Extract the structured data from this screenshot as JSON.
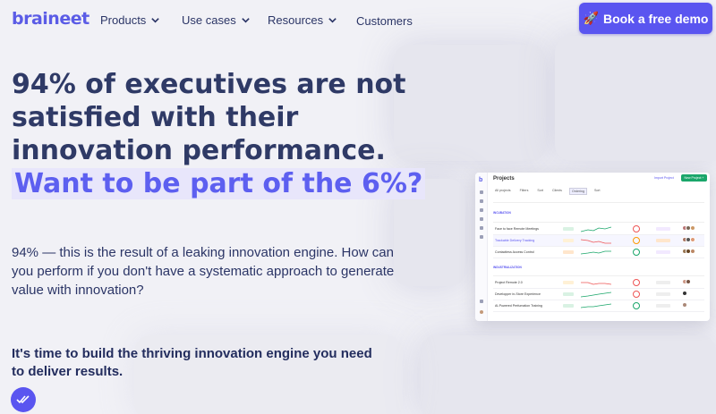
{
  "brand": {
    "logo_text": "braineet",
    "accent": "#5a55f0",
    "title_color": "#2f3a66"
  },
  "nav": {
    "items": [
      {
        "label": "Products",
        "has_dropdown": true
      },
      {
        "label": "Use cases",
        "has_dropdown": true
      },
      {
        "label": "Resources",
        "has_dropdown": true
      },
      {
        "label": "Customers",
        "has_dropdown": false
      }
    ],
    "cta": {
      "icon": "rocket-icon",
      "emoji": "🚀",
      "label": "Book a free demo"
    }
  },
  "hero": {
    "title_line1": "94% of executives are not satisfied with their innovation performance.",
    "title_highlight": "Want to be part of the 6%?",
    "description": "94% — this is the result of a leaking innovation engine. How can you perform if you don't have a systematic approach to generate value with innovation?",
    "cta_text": "It's time to build the thriving innovation engine you need to deliver results."
  },
  "app_preview": {
    "title": "Projects",
    "import_label": "Import Project",
    "new_label": "New Project +",
    "tabs": [
      "All projects",
      "Filters",
      "Sort",
      "Clients",
      "Ordering",
      "Sort"
    ],
    "groups": [
      {
        "name": "INCUBATION",
        "rows": [
          {
            "name": "Face to face Remote Meetings",
            "pill": "#d9f2e3",
            "tag": "#f2e9ff"
          },
          {
            "name": "Trackable Delivery Tracking",
            "pill": "#fff1d6",
            "tag": "#ffe6cc",
            "highlight": true
          },
          {
            "name": "Contactless Access Control",
            "pill": "#ffe6cc",
            "tag": "#f2e9ff"
          }
        ]
      },
      {
        "name": "INDUSTRIALIZATION",
        "rows": [
          {
            "name": "Project Remote 2.0",
            "pill": "#fff1d6",
            "tag": "#eeeeee"
          },
          {
            "name": "Developper in-Store Experience",
            "pill": "#d9f2e3",
            "tag": "#eeeeee"
          },
          {
            "name": "AI-Powered Perfumation Training",
            "pill": "#d9f2e3",
            "tag": "#eeeeee"
          }
        ]
      }
    ]
  }
}
